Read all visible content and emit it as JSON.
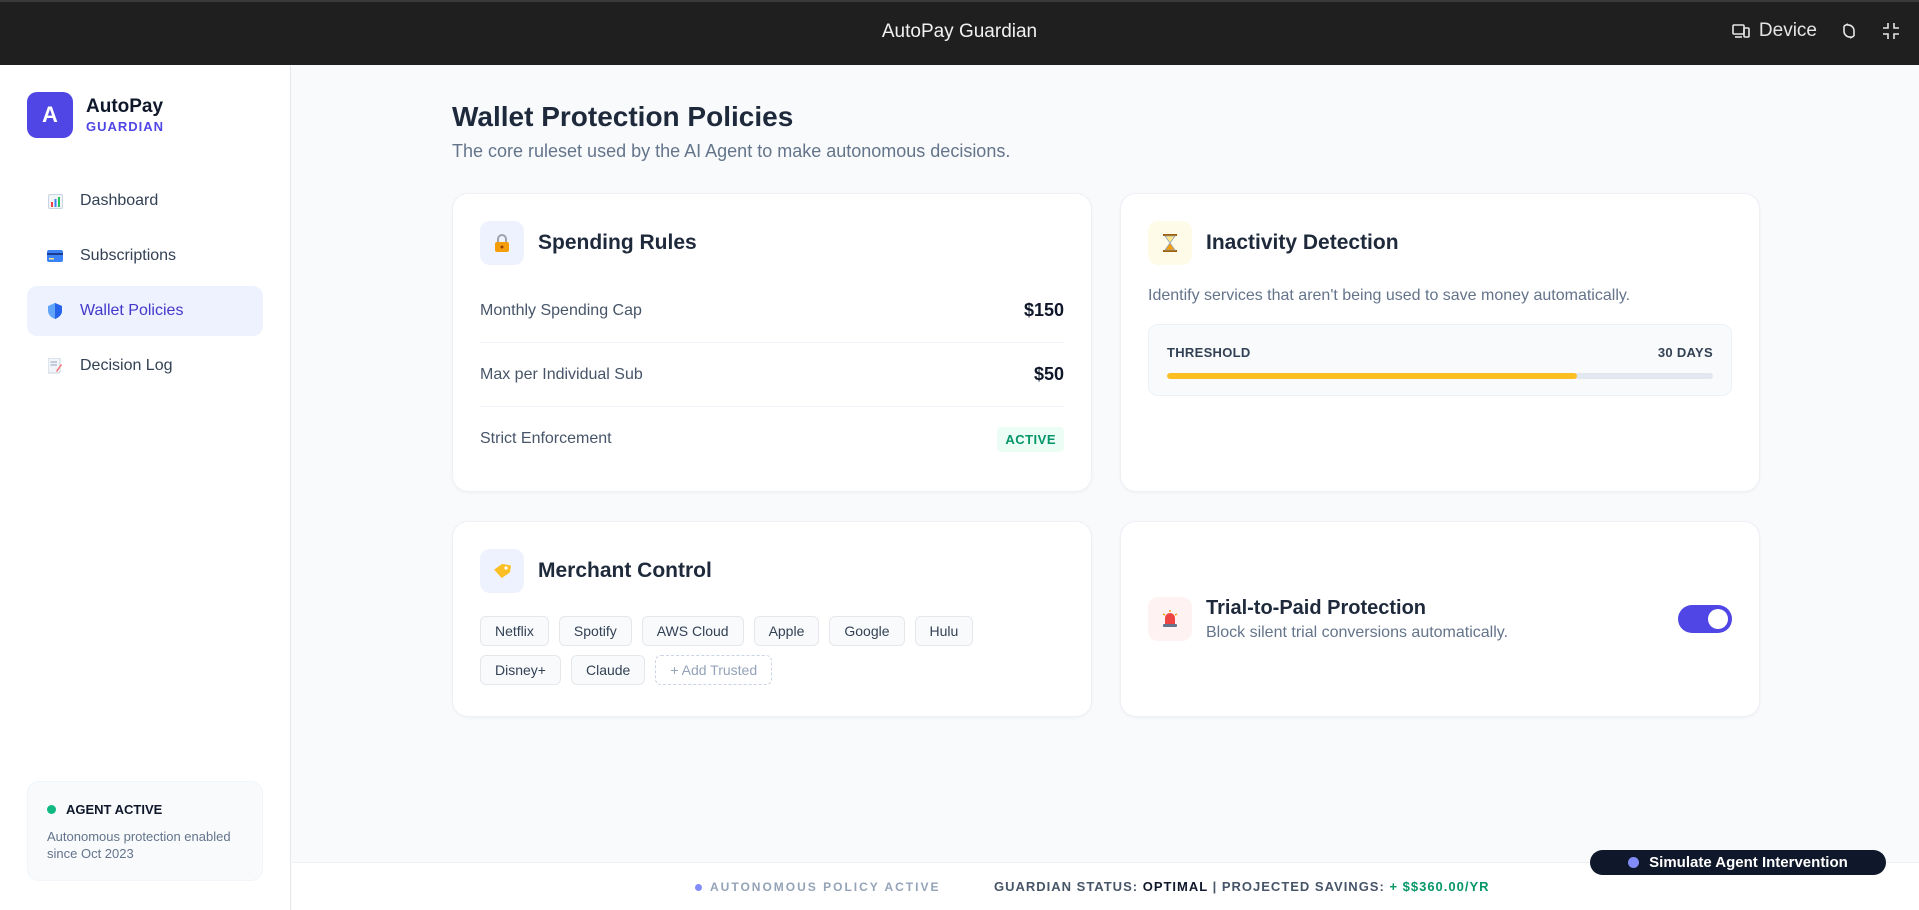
{
  "window": {
    "title": "AutoPay Guardian",
    "device_label": "Device",
    "icons": [
      "device-icon",
      "rotate-icon",
      "exit-fullscreen-icon"
    ]
  },
  "brand": {
    "logo_letter": "A",
    "name": "AutoPay",
    "sub": "GUARDIAN",
    "accent": "#4f46e5"
  },
  "sidebar": {
    "items": [
      {
        "label": "Dashboard",
        "icon": "bar-chart-icon",
        "active": false
      },
      {
        "label": "Subscriptions",
        "icon": "credit-card-icon",
        "active": false
      },
      {
        "label": "Wallet Policies",
        "icon": "shield-icon",
        "active": true
      },
      {
        "label": "Decision Log",
        "icon": "memo-icon",
        "active": false
      }
    ],
    "agent": {
      "status": "AGENT ACTIVE",
      "description": "Autonomous protection enabled since Oct 2023"
    }
  },
  "page": {
    "title": "Wallet Protection Policies",
    "subtitle": "The core ruleset used by the AI Agent to make autonomous decisions."
  },
  "spending": {
    "title": "Spending Rules",
    "icon": "lock-icon",
    "rows": [
      {
        "label": "Monthly Spending Cap",
        "value": "$150"
      },
      {
        "label": "Max per Individual Sub",
        "value": "$50"
      }
    ],
    "enforcement_label": "Strict Enforcement",
    "enforcement_badge": "ACTIVE"
  },
  "inactivity": {
    "title": "Inactivity Detection",
    "icon": "hourglass-icon",
    "description": "Identify services that aren't being used to save money automatically.",
    "threshold_label": "THRESHOLD",
    "threshold_value": "30 DAYS",
    "threshold_fill": 0.75,
    "fill_color": "#fbbf24"
  },
  "merchant": {
    "title": "Merchant Control",
    "icon": "tag-icon",
    "chips": [
      "Netflix",
      "Spotify",
      "AWS Cloud",
      "Apple",
      "Google",
      "Hulu",
      "Disney+",
      "Claude"
    ],
    "add_label": "+ Add Trusted"
  },
  "trial": {
    "title": "Trial-to-Paid Protection",
    "subtitle": "Block silent trial conversions automatically.",
    "icon": "siren-icon",
    "enabled": true
  },
  "footer": {
    "policy": "AUTONOMOUS POLICY ACTIVE",
    "status_prefix": "GUARDIAN STATUS:",
    "status_value": "OPTIMAL",
    "separator": "|",
    "savings_prefix": "PROJECTED SAVINGS:",
    "savings_value": "+ $$360.00/YR"
  },
  "simulate_button": "Simulate Agent Intervention"
}
